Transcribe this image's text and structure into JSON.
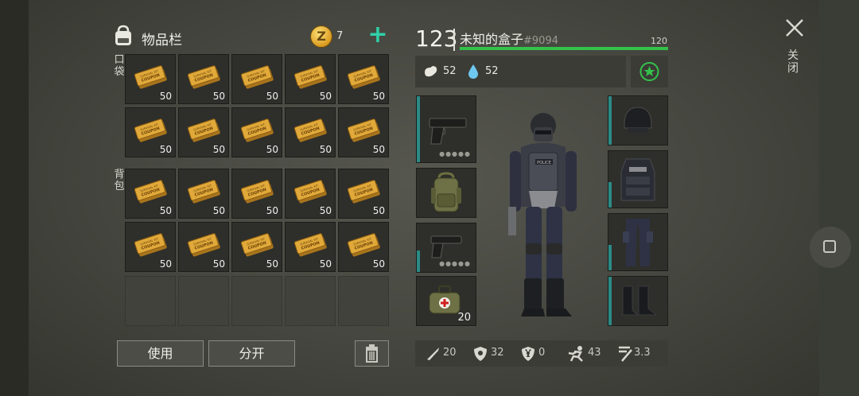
{
  "inventory": {
    "title": "物品栏",
    "coin_count": "7",
    "coin_symbol": "Z",
    "pocket_label": "口袋",
    "backpack_label": "背包",
    "slots": [
      {
        "qty": "50"
      },
      {
        "qty": "50"
      },
      {
        "qty": "50"
      },
      {
        "qty": "50"
      },
      {
        "qty": "50"
      },
      {
        "qty": "50"
      },
      {
        "qty": "50"
      },
      {
        "qty": "50"
      },
      {
        "qty": "50"
      },
      {
        "qty": "50"
      },
      {
        "qty": "50"
      },
      {
        "qty": "50"
      },
      {
        "qty": "50"
      },
      {
        "qty": "50"
      },
      {
        "qty": "50"
      },
      {
        "qty": "50"
      },
      {
        "qty": "50"
      },
      {
        "qty": "50"
      },
      {
        "qty": "50"
      },
      {
        "qty": "50"
      }
    ],
    "coupon_lines": [
      "SURVIVAL KIT",
      "COUPON"
    ],
    "use_label": "使用",
    "split_label": "分开"
  },
  "player": {
    "level": "123",
    "name": "未知的盒子",
    "id": "#9094",
    "xp_value": "120",
    "xp_fraction": 1.0,
    "food": "52",
    "water": "52"
  },
  "equipment": {
    "medkit_qty": "20"
  },
  "stats": {
    "attack": "20",
    "defense": "32",
    "radiation": "0",
    "speed": "43",
    "stealth": "3.3"
  },
  "window": {
    "close_label": "关闭"
  },
  "colors": {
    "xp_bar": "#34c24a",
    "accent_teal": "#2b8a86",
    "plus_green": "#2fd0a8"
  },
  "icons": [
    "backpack-icon",
    "coin-icon",
    "plus-icon",
    "coupon-icon",
    "trash-icon",
    "food-icon",
    "water-drop-icon",
    "star-icon",
    "pistol-icon",
    "backpack-item-icon",
    "medkit-icon",
    "helmet-icon",
    "vest-icon",
    "pants-icon",
    "boots-icon",
    "knife-icon",
    "shield-icon",
    "radiation-icon",
    "run-icon",
    "sneak-icon",
    "close-icon",
    "square-icon"
  ]
}
